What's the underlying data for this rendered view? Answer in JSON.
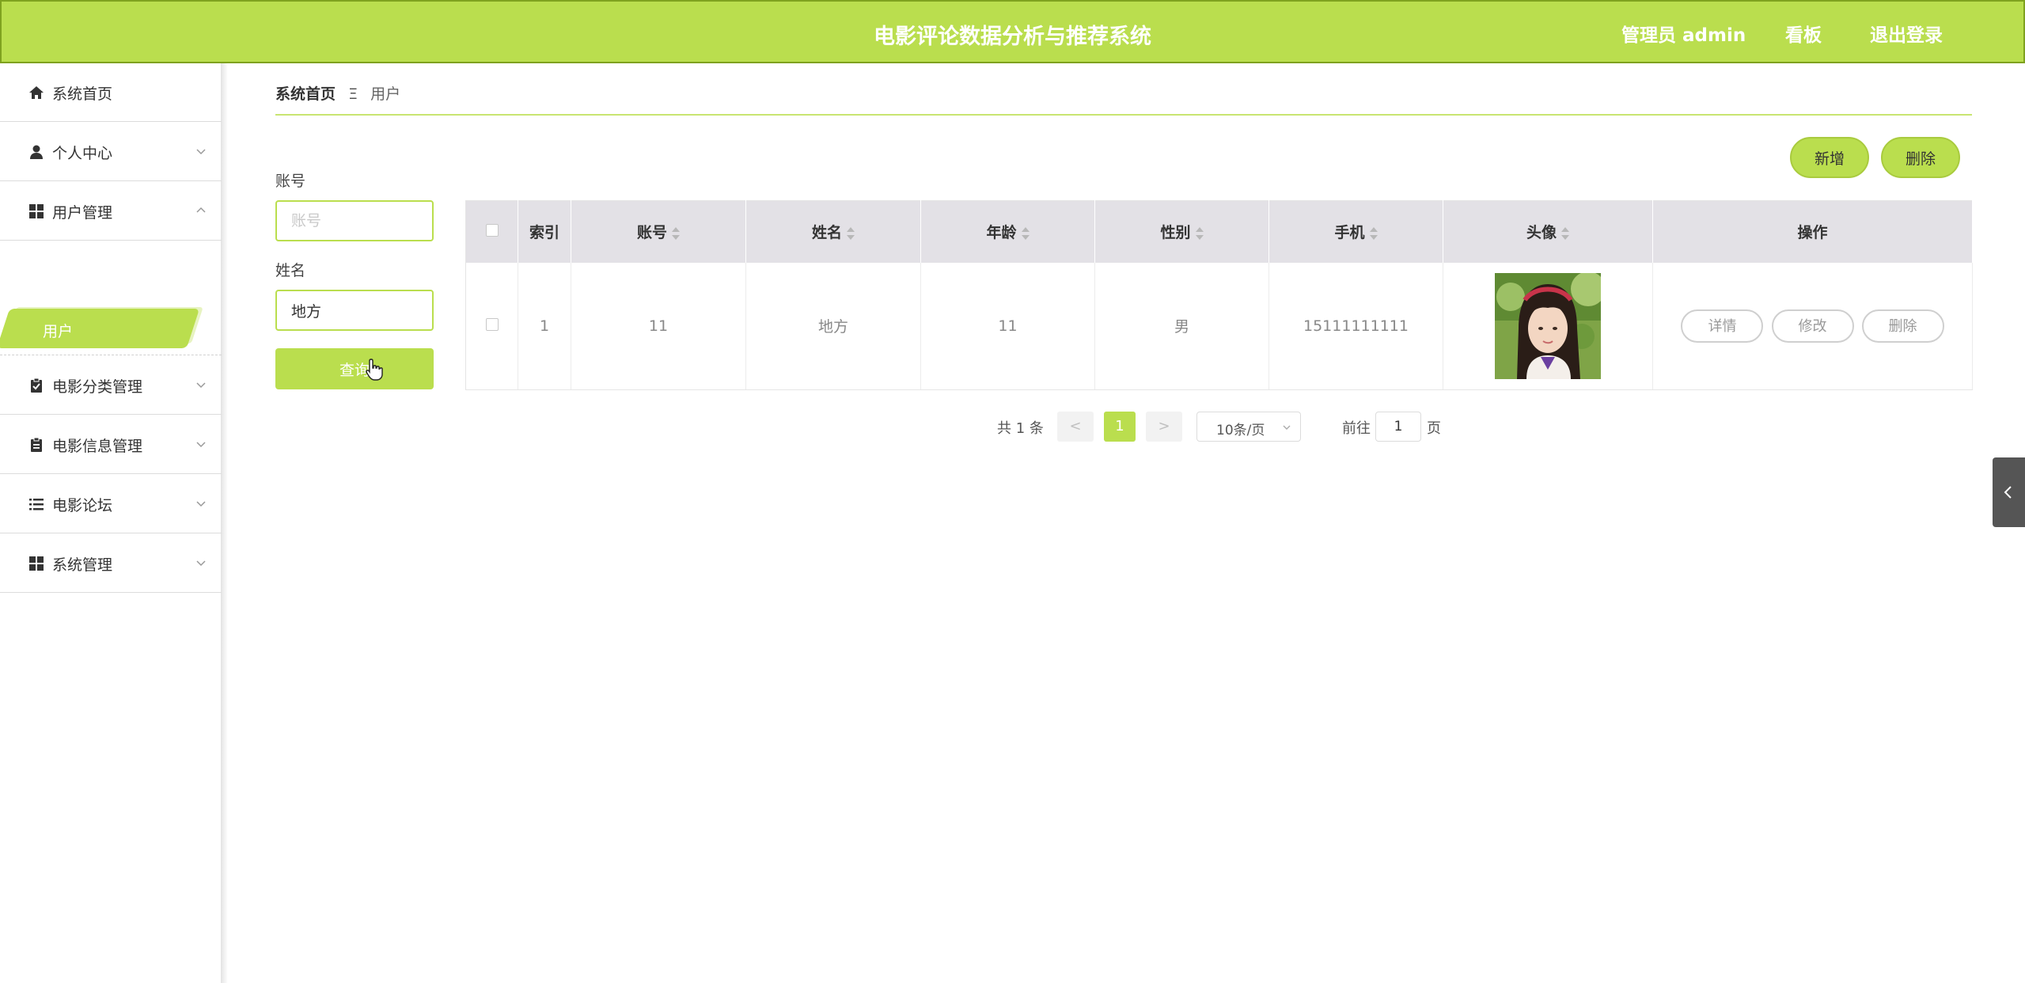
{
  "header": {
    "title": "电影评论数据分析与推荐系统",
    "admin": "管理员 admin",
    "board": "看板",
    "logout": "退出登录"
  },
  "sidebar": {
    "items": [
      {
        "label": "系统首页",
        "icon": "home-icon"
      },
      {
        "label": "个人中心",
        "icon": "user-icon"
      },
      {
        "label": "用户管理",
        "icon": "grid-icon",
        "expanded": true,
        "children": [
          {
            "label": "用户",
            "active": true
          }
        ]
      },
      {
        "label": "电影分类管理",
        "icon": "clipboard-check-icon"
      },
      {
        "label": "电影信息管理",
        "icon": "clipboard-icon"
      },
      {
        "label": "电影论坛",
        "icon": "list-icon"
      },
      {
        "label": "系统管理",
        "icon": "grid-icon"
      }
    ]
  },
  "breadcrumb": {
    "home": "系统首页",
    "separator": "Ξ",
    "current": "用户"
  },
  "search": {
    "account_label": "账号",
    "account_placeholder": "账号",
    "account_value": "",
    "name_label": "姓名",
    "name_value": "地方",
    "query_label": "查询"
  },
  "actions": {
    "add": "新增",
    "delete": "删除"
  },
  "table": {
    "columns": [
      "索引",
      "账号",
      "姓名",
      "年龄",
      "性别",
      "手机",
      "头像",
      "操作"
    ],
    "rows": [
      {
        "index": "1",
        "account": "11",
        "name": "地方",
        "age": "11",
        "gender": "男",
        "phone": "15111111111",
        "avatar": "avatar-photo"
      }
    ],
    "row_actions": [
      "详情",
      "修改",
      "删除"
    ]
  },
  "pagination": {
    "total": "共 1 条",
    "prev": "<",
    "current_page": "1",
    "next": ">",
    "page_size": "10条/页",
    "goto_label": "前往",
    "goto_value": "1",
    "page_suffix": "页"
  },
  "colors": {
    "accent": "#bade4e",
    "header_bg": "#e3e1e6"
  }
}
